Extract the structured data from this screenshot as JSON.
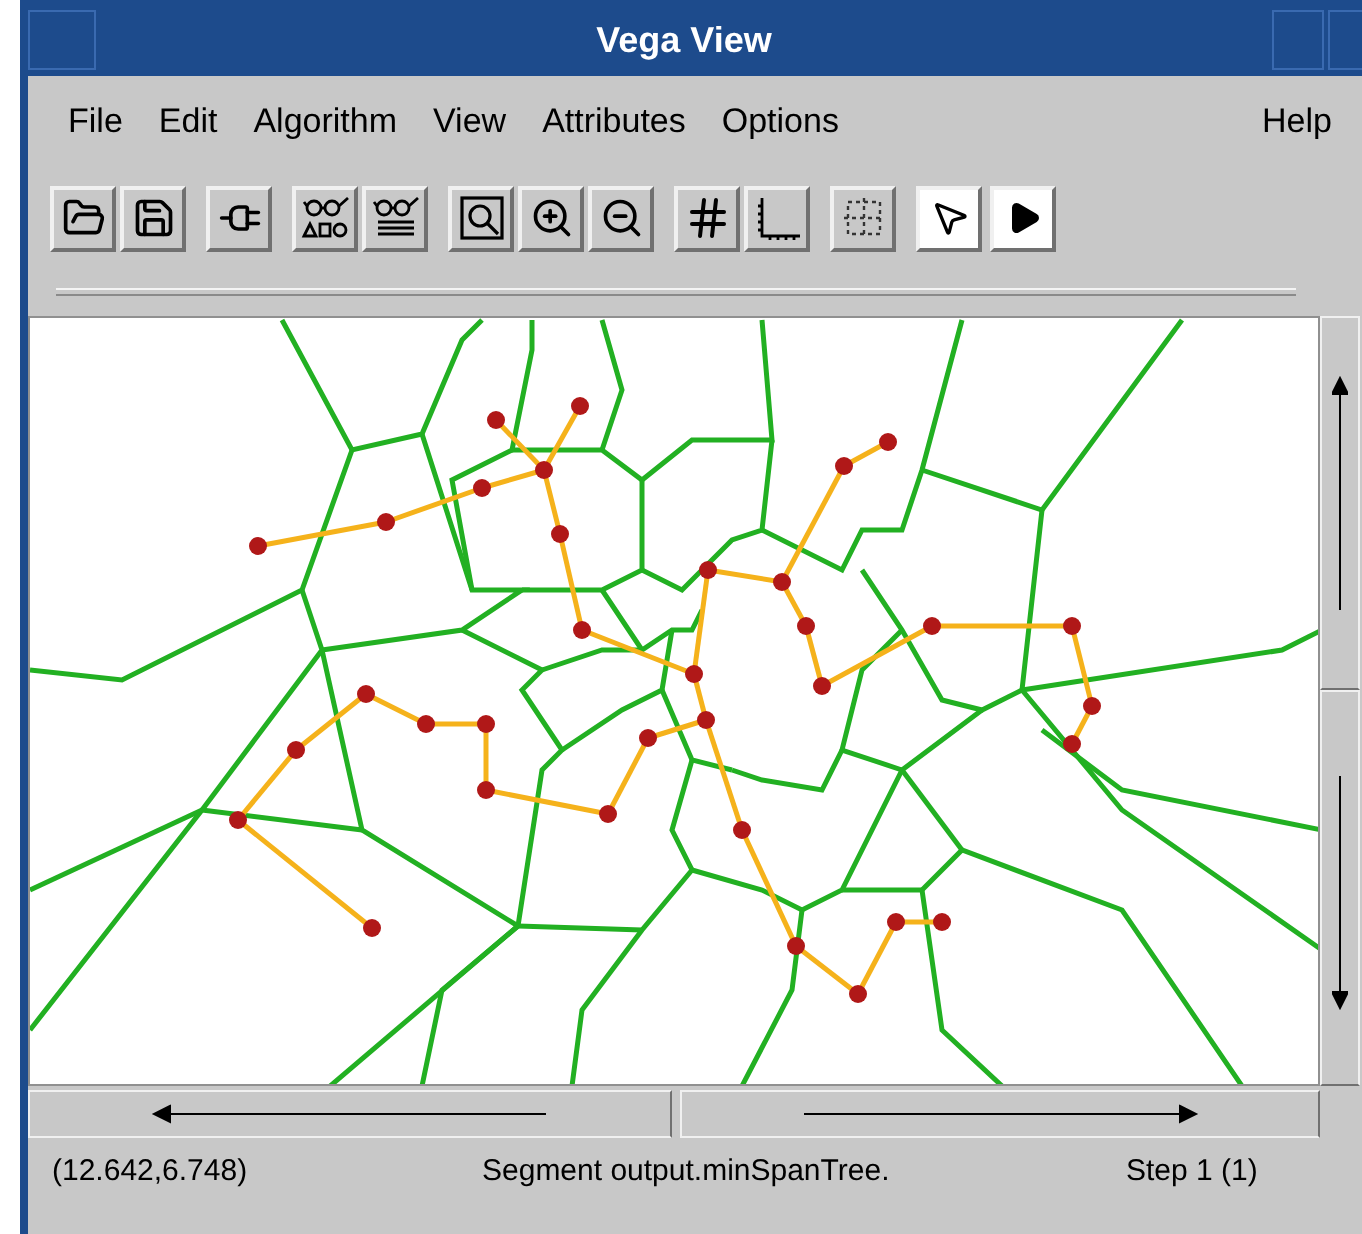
{
  "window": {
    "title": "Vega View"
  },
  "menu": [
    {
      "label": "File"
    },
    {
      "label": "Edit"
    },
    {
      "label": "Algorithm"
    },
    {
      "label": "View"
    },
    {
      "label": "Attributes"
    },
    {
      "label": "Options"
    },
    {
      "label": "Help"
    }
  ],
  "status_bar": {
    "coordinates": "(12.642,6.748)",
    "message": "Segment output.minSpanTree.",
    "step": "Step 1 (1)"
  }
}
